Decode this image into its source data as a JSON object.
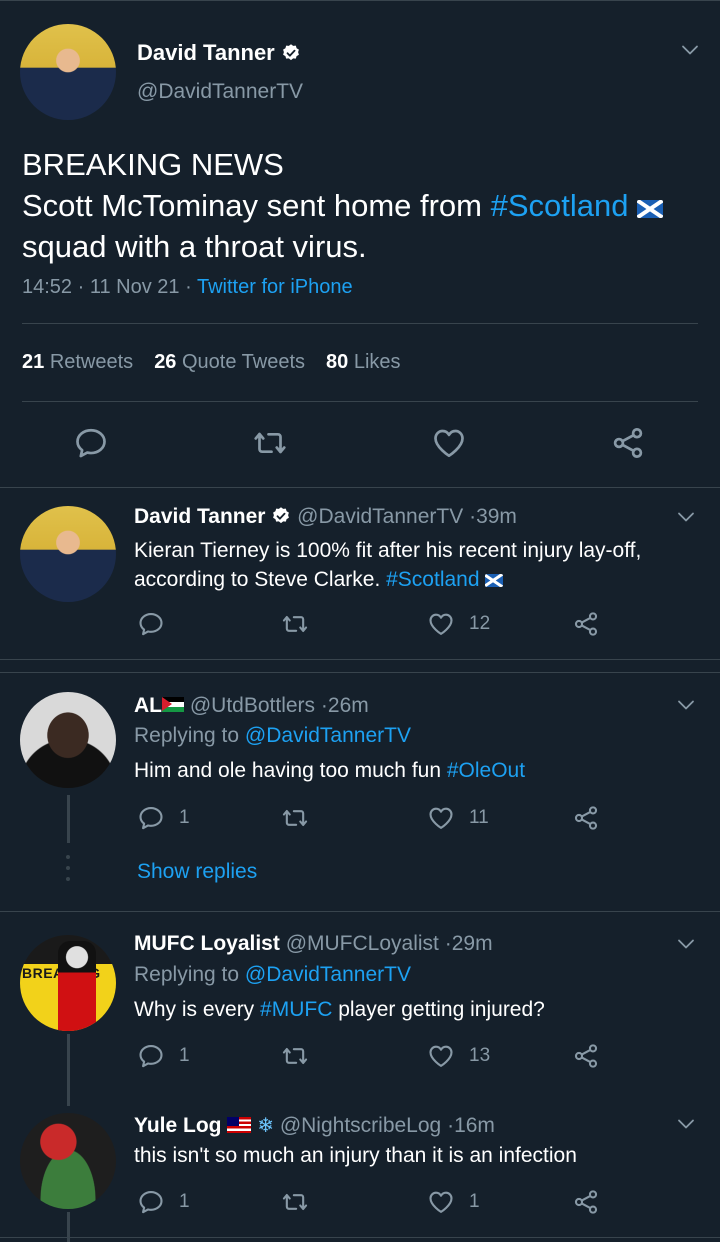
{
  "main_tweet": {
    "author_name": "David Tanner",
    "author_handle": "@DavidTannerTV",
    "text_line1": "BREAKING NEWS",
    "text_line2_prefix": "Scott McTominay sent home from ",
    "text_line2_hashtag": "#Scotland",
    "text_line3": "squad with a throat virus.",
    "time": "14:52",
    "date": "11 Nov 21",
    "source": "Twitter for iPhone",
    "retweets_count": "21",
    "retweets_label": "Retweets",
    "quotes_count": "26",
    "quotes_label": "Quote Tweets",
    "likes_count": "80",
    "likes_label": "Likes"
  },
  "replies": [
    {
      "author_name": "David Tanner",
      "author_handle": "@DavidTannerTV",
      "age": "39m",
      "text_line1": "Kieran Tierney is 100% fit after his recent injury lay-off,",
      "text_line2_prefix": "according to Steve Clarke. ",
      "hashtag": "#Scotland",
      "replies": "",
      "retweets": "",
      "likes": "12"
    },
    {
      "author_name": "AL",
      "author_handle": "@UtdBottlers",
      "age": "26m",
      "replying_label": "Replying to ",
      "replying_to": "@DavidTannerTV",
      "text_prefix": "Him and ole having too much fun ",
      "hashtag": "#OleOut",
      "replies": "1",
      "retweets": "",
      "likes": "11",
      "show_replies": "Show replies"
    },
    {
      "author_name": "MUFC Loyalist",
      "author_handle": "@MUFCLoyalist",
      "age": "29m",
      "replying_label": "Replying to ",
      "replying_to": "@DavidTannerTV",
      "text_prefix": "Why is every ",
      "hashtag": "#MUFC",
      "text_suffix": " player getting injured?",
      "avatar_text": "BREAKING",
      "replies": "1",
      "retweets": "",
      "likes": "13"
    },
    {
      "author_name": "Yule Log",
      "author_handle": "@NightscribeLog",
      "age": "16m",
      "text": "this isn't so much an injury than it is an infection",
      "replies": "1",
      "retweets": "",
      "likes": "1"
    }
  ],
  "separator": "·",
  "colors": {
    "background": "#15202b",
    "link": "#1da1f2",
    "muted": "#8899a6",
    "divider": "#38444d"
  },
  "icons": [
    "verified-badge-icon",
    "chevron-down-icon",
    "reply-icon",
    "retweet-icon",
    "like-icon",
    "share-icon",
    "scotland-flag-icon",
    "palestine-flag-icon",
    "malaysia-flag-icon",
    "snowflake-icon"
  ]
}
